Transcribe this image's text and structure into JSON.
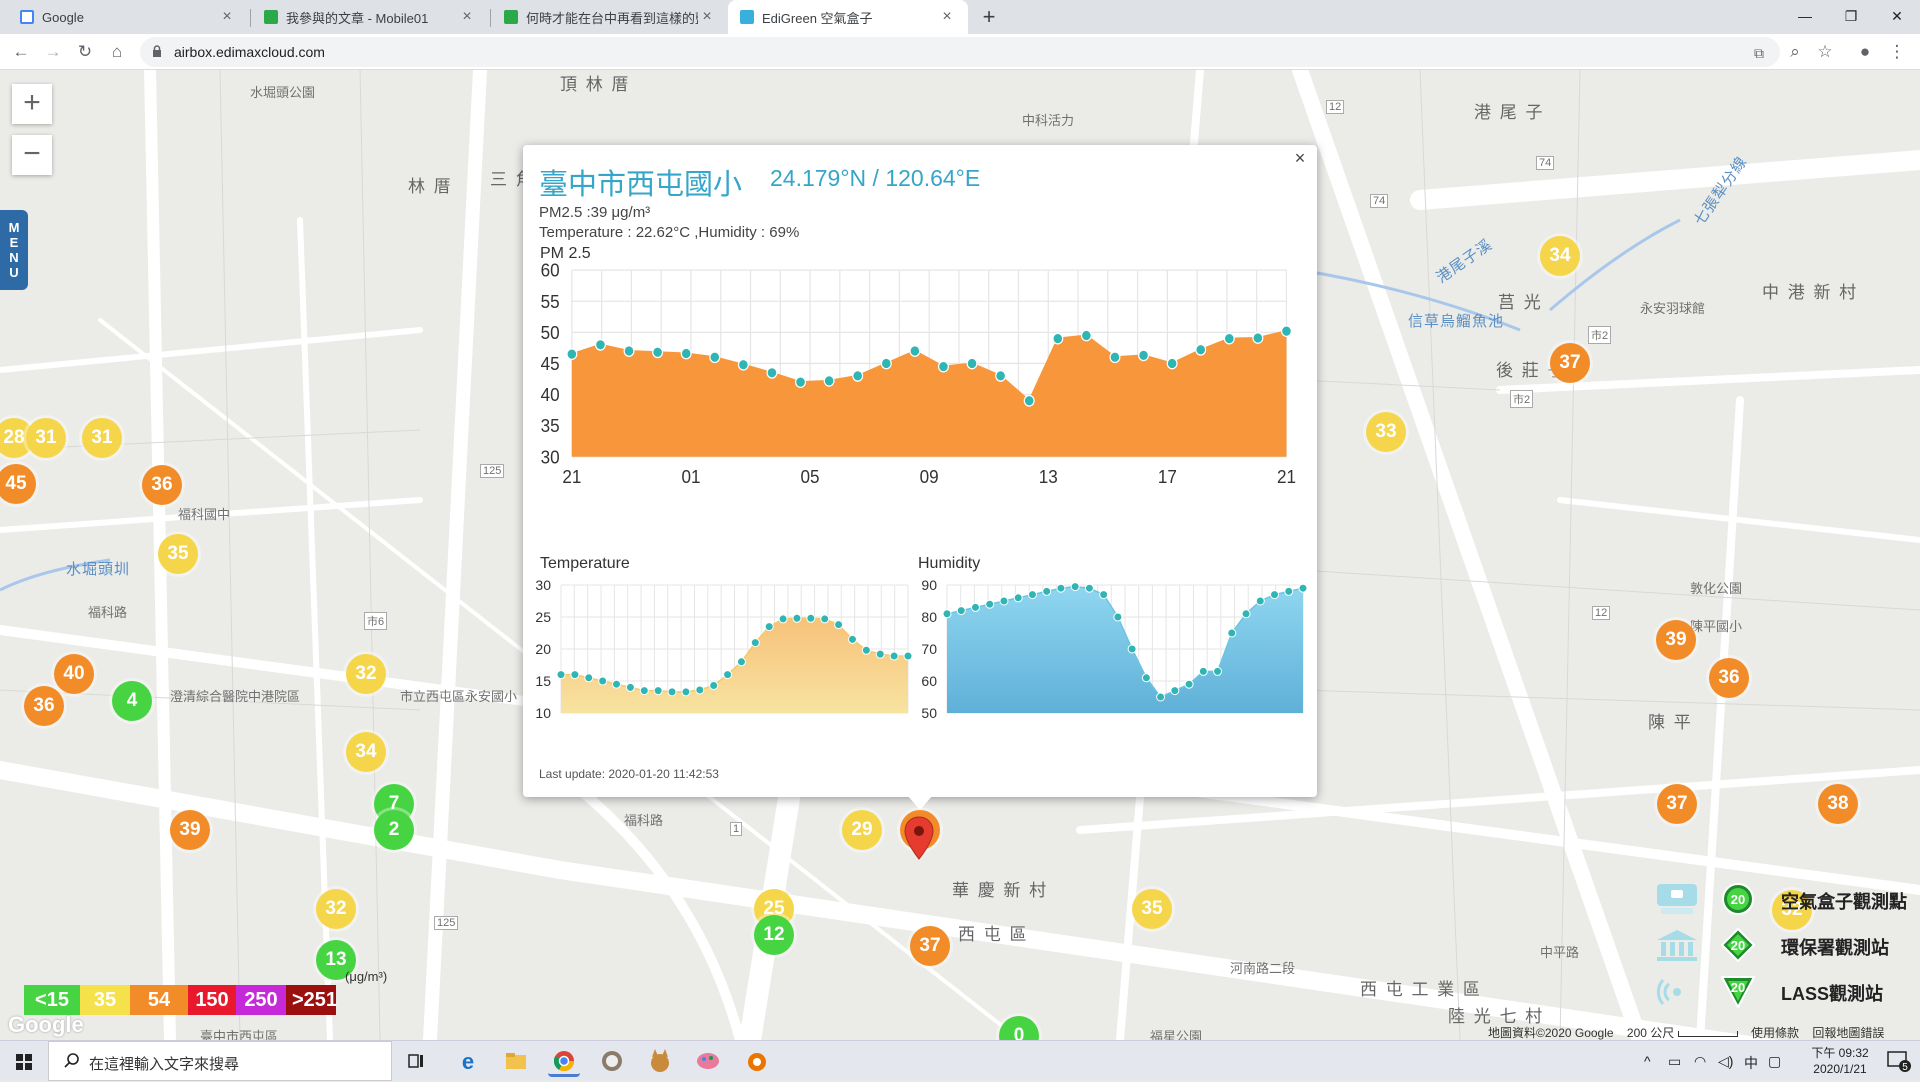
{
  "browser": {
    "tabs": [
      {
        "title": "Google",
        "favicon_color": "#4285f4",
        "active": false
      },
      {
        "title": "我參與的文章 - Mobile01",
        "favicon_color": "#2aa84a",
        "active": false
      },
      {
        "title": "何時才能在台中再看到這樣的藍天",
        "favicon_color": "#2aa84a",
        "active": false
      },
      {
        "title": "EdiGreen 空氣盒子",
        "favicon_color": "#38b0de",
        "active": true
      }
    ],
    "new_tab": "+",
    "url": "airbox.edimaxcloud.com"
  },
  "map": {
    "labels": [
      {
        "text": "頂 林 厝"
      },
      {
        "text": "水堀頭公園"
      },
      {
        "text": "林 厝"
      },
      {
        "text": "三 角"
      },
      {
        "text": "中科活力"
      },
      {
        "text": "港 尾 子"
      },
      {
        "text": "莒 光"
      },
      {
        "text": "後 莊 子"
      },
      {
        "text": "中 港 新 村"
      },
      {
        "text": "永安羽球館"
      },
      {
        "text": "信草烏鰡魚池"
      },
      {
        "text": "敦化公園"
      },
      {
        "text": "陳平國小"
      },
      {
        "text": "陳 平"
      },
      {
        "text": "水堀頭圳"
      },
      {
        "text": "福科路"
      },
      {
        "text": "澄清綜合醫院中港院區"
      },
      {
        "text": "市立西屯區永安國小"
      },
      {
        "text": "華 慶 新 村"
      },
      {
        "text": "西 屯 區"
      },
      {
        "text": "西 屯 工 業 區"
      },
      {
        "text": "陸 光 七 村"
      },
      {
        "text": "福星公園"
      },
      {
        "text": "河南路二段"
      },
      {
        "text": "中平路"
      },
      {
        "text": "港尾子溪"
      },
      {
        "text": "七張犁分線"
      },
      {
        "text": "福科國中"
      },
      {
        "text": "福科路"
      },
      {
        "text": "臺中市西屯區"
      }
    ],
    "markers": [
      {
        "value": "45",
        "level": "orange"
      },
      {
        "value": "28",
        "level": "yellow"
      },
      {
        "value": "31",
        "level": "yellow"
      },
      {
        "value": "31",
        "level": "yellow"
      },
      {
        "value": "36",
        "level": "orange"
      },
      {
        "value": "35",
        "level": "yellow"
      },
      {
        "value": "40",
        "level": "orange"
      },
      {
        "value": "36",
        "level": "orange"
      },
      {
        "value": "4",
        "level": "green"
      },
      {
        "value": "32",
        "level": "yellow"
      },
      {
        "value": "34",
        "level": "yellow"
      },
      {
        "value": "7",
        "level": "green"
      },
      {
        "value": "2",
        "level": "green"
      },
      {
        "value": "39",
        "level": "orange"
      },
      {
        "value": "32",
        "level": "yellow"
      },
      {
        "value": "13",
        "level": "green"
      },
      {
        "value": "29",
        "level": "yellow"
      },
      {
        "value": "39",
        "level": "orange"
      },
      {
        "value": "25",
        "level": "yellow"
      },
      {
        "value": "12",
        "level": "green"
      },
      {
        "value": "37",
        "level": "orange"
      },
      {
        "value": "0",
        "level": "green"
      },
      {
        "value": "35",
        "level": "yellow"
      },
      {
        "value": "34",
        "level": "yellow"
      },
      {
        "value": "37",
        "level": "orange"
      },
      {
        "value": "33",
        "level": "yellow"
      },
      {
        "value": "39",
        "level": "orange"
      },
      {
        "value": "36",
        "level": "orange"
      },
      {
        "value": "37",
        "level": "orange"
      },
      {
        "value": "38",
        "level": "orange"
      },
      {
        "value": "32",
        "level": "yellow"
      }
    ],
    "zoom_in": "+",
    "zoom_out": "−",
    "menu_letters": [
      "M",
      "E",
      "N",
      "U"
    ],
    "road_numbers": [
      "125",
      "市6",
      "125",
      "74",
      "74",
      "12",
      "市2",
      "市2",
      "12",
      "1"
    ]
  },
  "popup": {
    "station_name": "臺中市西屯國小",
    "coords": "24.179°N / 120.64°E",
    "pm_line": "PM2.5 :39 μg/m³",
    "temp_hum_line": "Temperature : 22.62°C ,Humidity : 69%",
    "pm_chart_title": "PM 2.5",
    "temp_chart_title": "Temperature",
    "hum_chart_title": "Humidity",
    "last_update": "Last update: 2020-01-20 11:42:53",
    "close": "×"
  },
  "chart_data": [
    {
      "type": "area",
      "title": "PM 2.5",
      "x_ticks": [
        "21",
        "01",
        "05",
        "09",
        "13",
        "17",
        "21"
      ],
      "ylim": [
        30,
        60
      ],
      "y_ticks": [
        30,
        35,
        40,
        45,
        50,
        55,
        60
      ],
      "grid": true,
      "color": "#f7963b",
      "values": [
        46.5,
        48,
        47,
        46.8,
        46.6,
        46,
        44.8,
        43.5,
        42,
        42.2,
        43,
        45,
        47,
        44.5,
        45,
        43,
        39,
        49,
        49.5,
        46,
        46.3,
        45,
        47.2,
        49,
        49.1,
        50.2
      ]
    },
    {
      "type": "area",
      "title": "Temperature",
      "ylim": [
        10,
        30
      ],
      "y_ticks": [
        10,
        15,
        20,
        25,
        30
      ],
      "grid": true,
      "color": "#f5d58c",
      "values": [
        16,
        16,
        15.5,
        15,
        14.5,
        14,
        13.5,
        13.5,
        13.3,
        13.3,
        13.6,
        14.3,
        16,
        18,
        21,
        23.5,
        24.7,
        24.8,
        24.8,
        24.7,
        23.8,
        21.5,
        19.8,
        19.2,
        18.9,
        18.9
      ]
    },
    {
      "type": "area",
      "title": "Humidity",
      "ylim": [
        50,
        90
      ],
      "y_ticks": [
        50,
        60,
        70,
        80,
        90
      ],
      "grid": true,
      "color": "#7dcdea",
      "values": [
        81,
        82,
        83,
        84,
        85,
        86,
        87,
        88,
        89,
        89.5,
        89,
        87,
        80,
        70,
        61,
        55,
        57,
        59,
        63,
        63,
        75,
        81,
        85,
        87,
        88,
        89
      ]
    }
  ],
  "aqi_legend": {
    "segments": [
      {
        "label": "<15",
        "color": "#47d443",
        "text_color": "#ffffff"
      },
      {
        "label": "35",
        "color": "#f5e24a",
        "text_color": "#ffffff"
      },
      {
        "label": "54",
        "color": "#f28c28",
        "text_color": "#ffffff"
      },
      {
        "label": "150",
        "color": "#e8192c",
        "text_color": "#ffffff"
      },
      {
        "label": "250",
        "color": "#c62ad8",
        "text_color": "#ffffff"
      },
      {
        "label": ">251",
        "color": "#9b0f0f",
        "text_color": "#ffffff"
      }
    ],
    "unit": "(μg/m³)"
  },
  "station_legend": [
    {
      "badge": "20",
      "label": "空氣盒子觀測點",
      "icon": "airbox-icon"
    },
    {
      "badge": "20",
      "label": "環保署觀測站",
      "icon": "government-building-icon"
    },
    {
      "badge": "20",
      "label": "LASS觀測站",
      "icon": "lass-signal-icon"
    }
  ],
  "map_attribution": {
    "data": "地圖資料©2020 Google",
    "scale": "200 公尺",
    "terms": "使用條款",
    "report": "回報地圖錯誤"
  },
  "google_logo": "Google",
  "taskbar": {
    "search_placeholder": "在這裡輸入文字來搜尋",
    "ime": "中",
    "time": "下午 09:32",
    "date": "2020/1/21",
    "notification_count": "5"
  }
}
